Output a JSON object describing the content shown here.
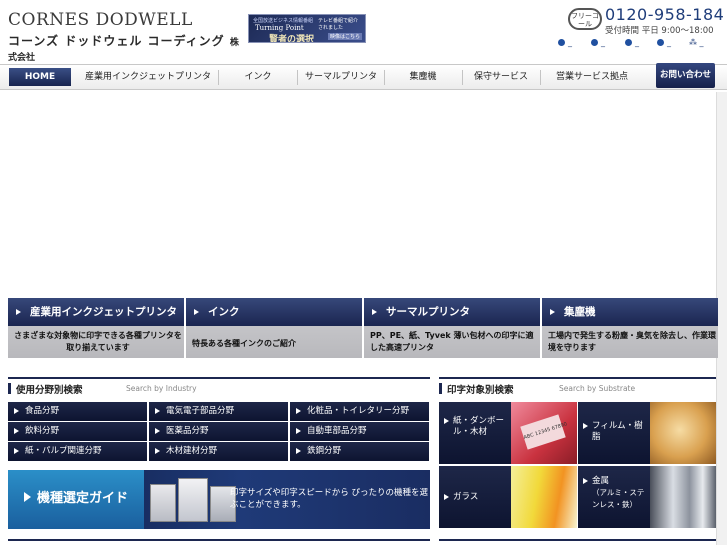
{
  "header": {
    "logo_en": "CORNES DODWELL",
    "logo_jp": "コーンズ ドッドウェル コーディング",
    "logo_jp_suffix": "株式会社",
    "banner": {
      "line1": "全国放送ビジネス情報番組",
      "line2": "Turning Point",
      "line3": "賢者の選択",
      "line4": "テレビ番組で紹介されました",
      "button": "映像はこちら"
    },
    "phone": {
      "freecall": "フリーコール",
      "number": "0120-958-184",
      "hours_label": "受付時間",
      "hours": "平日 9:00～18:00"
    }
  },
  "nav": {
    "home": "HOME",
    "items": [
      "産業用インクジェットプリンタ",
      "インク",
      "サーマルプリンタ",
      "集塵機",
      "保守サービス",
      "営業サービス拠点"
    ],
    "contact": "お問い合わせ"
  },
  "panels": [
    {
      "title": "産業用インクジェットプリンタ",
      "desc": "さまざまな対象物に印字できる各種プリンタを取り揃えています"
    },
    {
      "title": "インク",
      "desc": "特長ある各種インクのご紹介"
    },
    {
      "title": "サーマルプリンタ",
      "desc": "PP、PE、紙、Tyvek 薄い包材への印字に適した高速プリンタ"
    },
    {
      "title": "集塵機",
      "desc": "工場内で発生する粉塵・臭気を除去し、作業環境を守ります"
    }
  ],
  "industry": {
    "title": "使用分野別検索",
    "subtitle": "Search by Industry",
    "items": [
      "食品分野",
      "電気電子部品分野",
      "化粧品・トイレタリー分野",
      "飲料分野",
      "医薬品分野",
      "自動車部品分野",
      "紙・パルプ関連分野",
      "木材建材分野",
      "鉄鋼分野"
    ]
  },
  "guide": {
    "title": "機種選定ガイド",
    "desc": "印字サイズや印字スピードから ぴったりの機種を選ぶことができます。"
  },
  "substrate": {
    "title": "印字対象別検索",
    "subtitle": "Search by Substrate",
    "items": [
      {
        "label": "紙・ダンボール・木材",
        "img_text": "ABC 12345 67890"
      },
      {
        "label": "フィルム・樹脂",
        "small": ""
      },
      {
        "label": "ガラス",
        "small": ""
      },
      {
        "label": "金属",
        "small": "（アルミ・ステンレス・鉄）"
      }
    ]
  }
}
